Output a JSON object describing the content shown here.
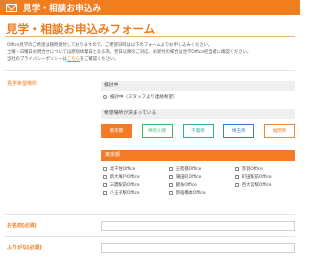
{
  "header": {
    "banner_title": "見学・相談お申込み",
    "form_title": "見学・相談お申込みフォーム"
  },
  "notes": {
    "line1": "Office見学のご希望は随時受付しておりますので、ご希望日時は以下のフォームよりお申し込みください。",
    "line2": "土曜・日曜日お問合せについては原則休業日となる為、翌日以降のご対応、お受付の場合は見学Office担当者に確認ください。",
    "line3_pre": "当社のプライバシーポリシーは",
    "line3_link": "こちら",
    "line3_post": "をご確認ください。"
  },
  "wish_section": {
    "label": "見学希望場所",
    "undecided_header": "検討中",
    "undecided_option": "検討中（スタッフより連絡希望）",
    "decided_header": "希望場所が決まっている"
  },
  "regions": [
    {
      "label": "東京都",
      "style": "active"
    },
    {
      "label": "神奈川県",
      "style": "green"
    },
    {
      "label": "千葉県",
      "style": "teal"
    },
    {
      "label": "埼玉県",
      "style": "blue"
    },
    {
      "label": "福岡県",
      "style": "orange"
    }
  ],
  "tokyo": {
    "header": "東京都",
    "offices": [
      "北千住Office",
      "王睦都Office",
      "赤羽Office",
      "新大塚戸Office",
      "蒲田町Office",
      "町田駅前Office",
      "三鷹駅前Office",
      "錦糸Office",
      "西大宮駅Office",
      "八王子駅Office",
      "新宿橋本Office"
    ]
  },
  "fields": {
    "name_label": "お名前",
    "kana_label": "ふりがな",
    "required_mark": "[必須]"
  },
  "colors": {
    "accent": "#f27d1f",
    "green": "#3fb66a",
    "teal": "#2fa9a3",
    "blue": "#3f7fd6"
  }
}
